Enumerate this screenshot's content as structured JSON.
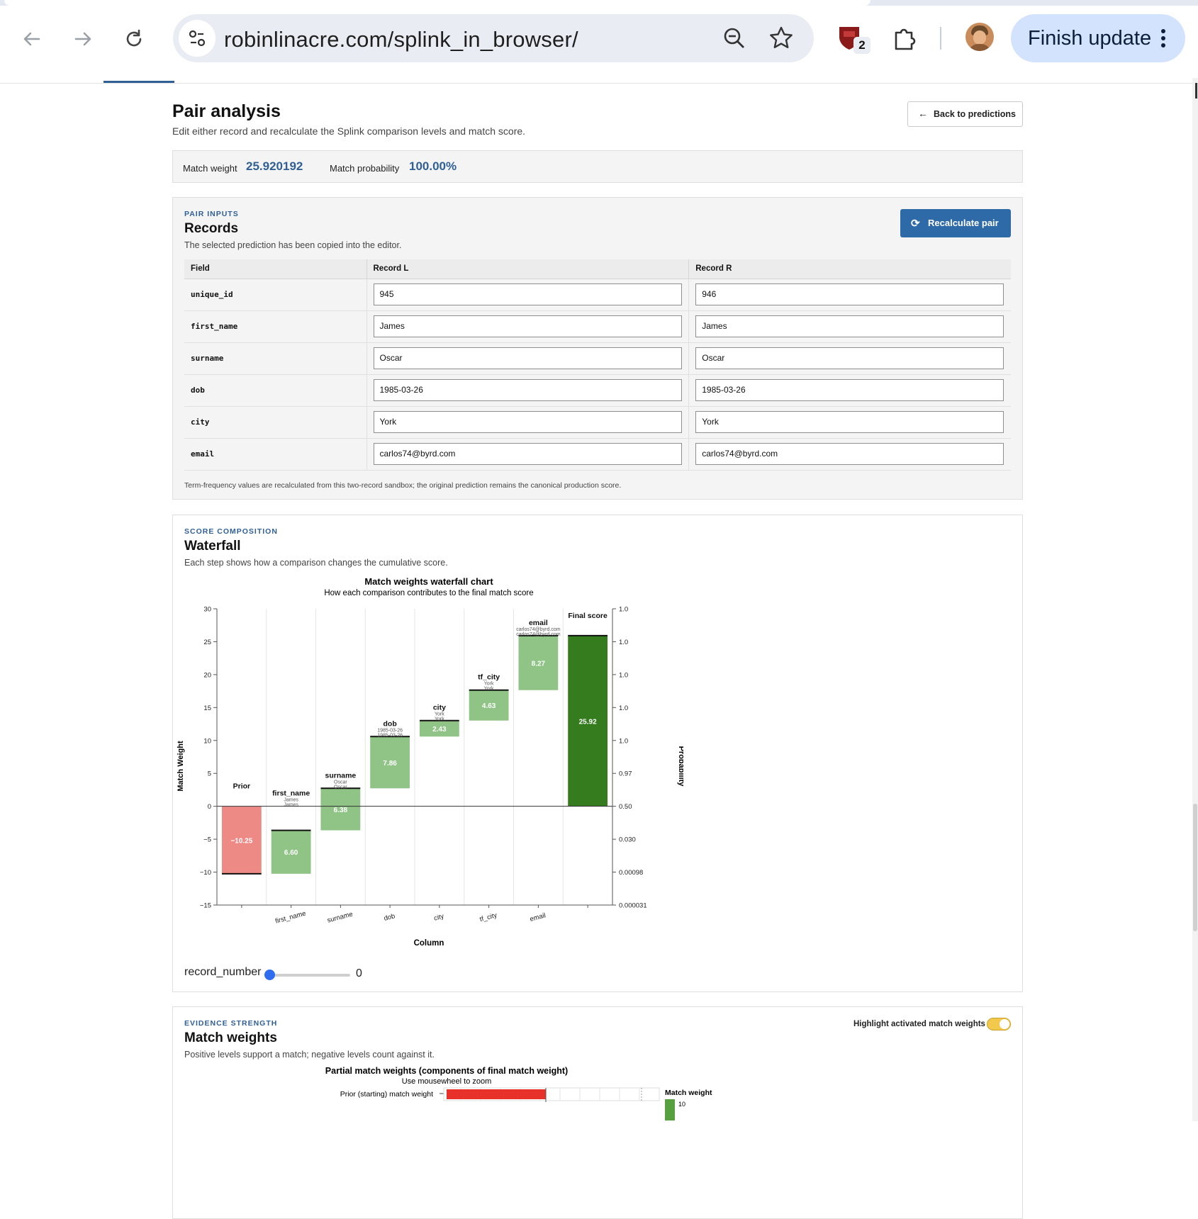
{
  "browser": {
    "url": "robinlinacre.com/splink_in_browser/",
    "extension_badge": "2",
    "finish_update_label": "Finish update"
  },
  "header": {
    "title": "Pair analysis",
    "subtitle": "Edit either record and recalculate the Splink comparison levels and match score.",
    "back_label": "Back to predictions"
  },
  "score": {
    "weight_label": "Match weight",
    "weight_value": "25.920192",
    "prob_label": "Match probability",
    "prob_value": "100.00%"
  },
  "pair_inputs": {
    "eyebrow": "PAIR INPUTS",
    "title": "Records",
    "subtitle": "The selected prediction has been copied into the editor.",
    "recalc_label": "Recalculate pair",
    "columns": [
      "Field",
      "Record L",
      "Record R"
    ],
    "rows": [
      {
        "field": "unique_id",
        "left": "945",
        "right": "946"
      },
      {
        "field": "first_name",
        "left": "James",
        "right": "James"
      },
      {
        "field": "surname",
        "left": "Oscar",
        "right": "Oscar"
      },
      {
        "field": "dob",
        "left": "1985-03-26",
        "right": "1985-03-26"
      },
      {
        "field": "city",
        "left": "York",
        "right": "York"
      },
      {
        "field": "email",
        "left": "carlos74@byrd.com",
        "right": "carlos74@byrd.com"
      }
    ],
    "note": "Term-frequency values are recalculated from this two-record sandbox; the original prediction remains the canonical production score."
  },
  "waterfall": {
    "eyebrow": "SCORE COMPOSITION",
    "title": "Waterfall",
    "subtitle": "Each step shows how a comparison changes the cumulative score.",
    "slider_label": "record_number",
    "slider_value": "0"
  },
  "chart_data": {
    "type": "bar",
    "title": "Match weights waterfall chart",
    "subtitle": "How each comparison contributes to the final match score",
    "xlabel": "Column",
    "ylabel": "Match Weight",
    "y2label": "Probability",
    "ylim": [
      -15,
      30
    ],
    "yticks": [
      "30",
      "25",
      "20",
      "15",
      "10",
      "5",
      "0",
      "−5",
      "−10",
      "−15"
    ],
    "y2ticks": [
      "1.0",
      "1.0",
      "1.0",
      "1.0",
      "1.0",
      "0.97",
      "0.50",
      "0.030",
      "0.00098",
      "0.000031"
    ],
    "x_tick_labels": [
      "first_name",
      "surname",
      "dob",
      "city",
      "tf_city",
      "email"
    ],
    "steps": [
      {
        "label": "Prior",
        "value": -10.25,
        "value_label": "−10.25",
        "l": "",
        "r": ""
      },
      {
        "label": "first_name",
        "value": 6.6,
        "value_label": "6.60",
        "l": "James",
        "r": "James"
      },
      {
        "label": "surname",
        "value": 6.38,
        "value_label": "6.38",
        "l": "Oscar",
        "r": "Oscar"
      },
      {
        "label": "dob",
        "value": 7.86,
        "value_label": "7.86",
        "l": "1985-03-26",
        "r": "1985-03-26"
      },
      {
        "label": "city",
        "value": 2.43,
        "value_label": "2.43",
        "l": "York",
        "r": "York"
      },
      {
        "label": "tf_city",
        "value": 4.63,
        "value_label": "4.63",
        "l": "York",
        "r": "York"
      },
      {
        "label": "email",
        "value": 8.27,
        "value_label": "8.27",
        "l": "carlos74@byrd.com",
        "r": "carlos74@byrd.com"
      },
      {
        "label": "Final score",
        "value": 25.92,
        "value_label": "25.92",
        "l": "",
        "r": "",
        "final": true
      }
    ],
    "colors": {
      "negative": "#ee8a86",
      "positive": "#8fc486",
      "final": "#357c1f"
    }
  },
  "match_weights": {
    "eyebrow": "EVIDENCE STRENGTH",
    "title": "Match weights",
    "subtitle": "Positive levels support a match; negative levels count against it.",
    "toggle_label": "Highlight activated match weights",
    "toggle_on": true,
    "chart_title": "Partial match weights (components of final match weight)",
    "chart_subtitle": "Use mousewheel to zoom",
    "row_label": "Prior (starting) match weight",
    "legend_title": "Match weight",
    "legend_tick": "10"
  }
}
